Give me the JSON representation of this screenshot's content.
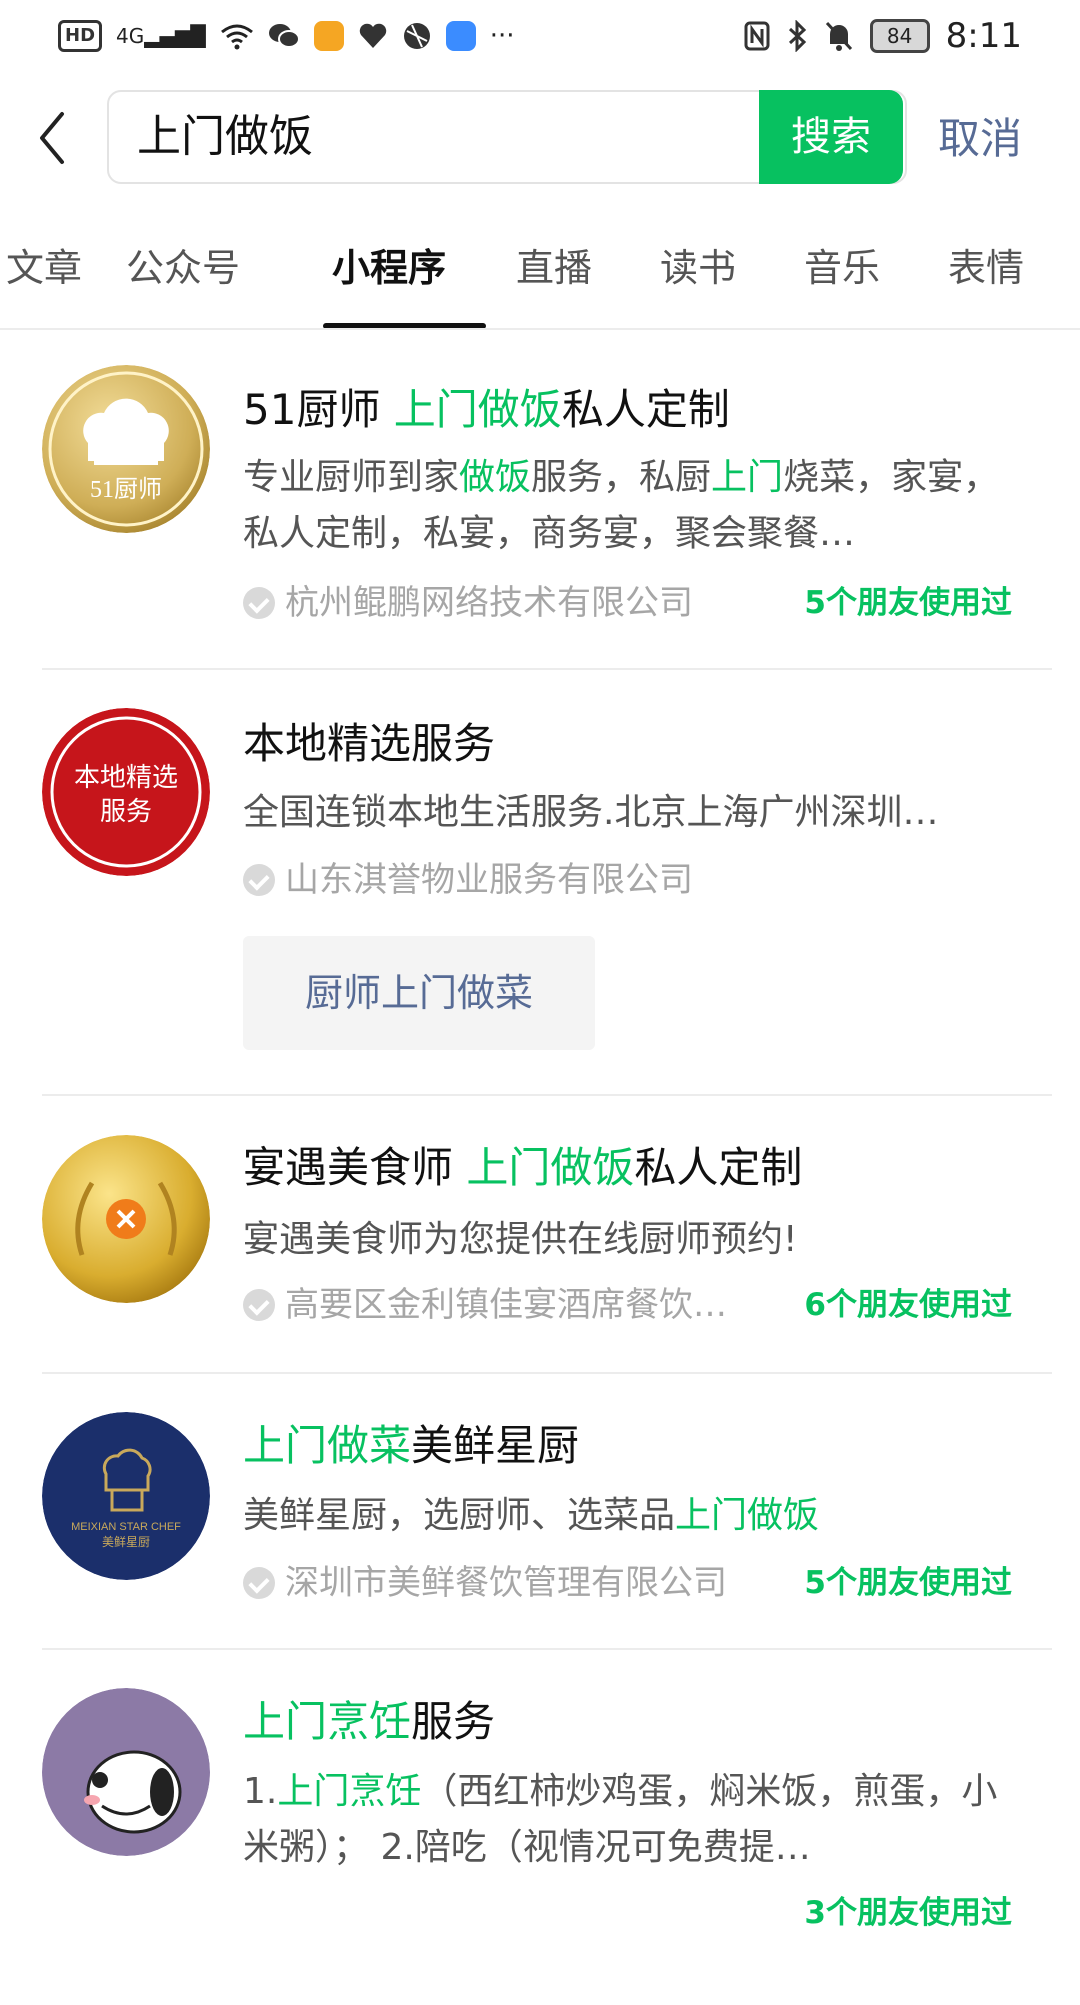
{
  "status_bar": {
    "hd": "HD",
    "network": "4G",
    "battery": "84",
    "time": "8:11",
    "overflow": "···"
  },
  "header": {
    "search_value": "上门做饭",
    "search_button": "搜索",
    "cancel": "取消"
  },
  "tabs": [
    {
      "label": "文章"
    },
    {
      "label": "公众号"
    },
    {
      "label": "小程序"
    },
    {
      "label": "直播"
    },
    {
      "label": "读书"
    },
    {
      "label": "音乐"
    },
    {
      "label": "表情"
    }
  ],
  "active_tab": "小程序",
  "results": [
    {
      "title_pre": "51厨师 ",
      "title_hl": "上门做饭",
      "title_post": "私人定制",
      "desc": [
        {
          "t": "专业厨师到家",
          "h": false
        },
        {
          "t": "做饭",
          "h": true
        },
        {
          "t": "服务，私厨",
          "h": false
        },
        {
          "t": "上门",
          "h": true
        },
        {
          "t": "烧菜，家宴，私人定制，私宴，商务宴，聚会聚餐…",
          "h": false
        }
      ],
      "source": "杭州鲲鹏网络技术有限公司",
      "friends": "5个朋友使用过",
      "avatar_text": "51厨师"
    },
    {
      "title_pre": "本地精选服务",
      "title_hl": "",
      "title_post": "",
      "desc": [
        {
          "t": "全国连锁本地生活服务.北京上海广州深圳…",
          "h": false
        }
      ],
      "source": "山东淇誉物业服务有限公司",
      "friends": "",
      "service": "厨师上门做菜",
      "avatar_text_line1": "本地精选",
      "avatar_text_line2": "服务"
    },
    {
      "title_pre": "宴遇美食师 ",
      "title_hl": "上门做饭",
      "title_post": "私人定制",
      "desc": [
        {
          "t": "宴遇美食师为您提供在线厨师预约!",
          "h": false
        }
      ],
      "source": "高要区金利镇佳宴酒席餐饮…",
      "friends": "6个朋友使用过"
    },
    {
      "title_pre": "",
      "title_hl": "上门做菜",
      "title_post": "美鲜星厨",
      "desc": [
        {
          "t": "美鲜星厨，选厨师、选菜品",
          "h": false
        },
        {
          "t": "上门做饭",
          "h": true
        }
      ],
      "source": "深圳市美鲜餐饮管理有限公司",
      "friends": "5个朋友使用过",
      "avatar_text_line1": "MEIXIAN STAR CHEF",
      "avatar_text_line2": "美鲜星厨"
    },
    {
      "title_pre": "",
      "title_hl": "上门烹饪",
      "title_post": "服务",
      "desc": [
        {
          "t": "1.",
          "h": false
        },
        {
          "t": "上门烹饪",
          "h": true
        },
        {
          "t": "（西红柿炒鸡蛋，焖米饭，煎蛋，小米粥）； 2.陪吃（视情况可免费提…",
          "h": false
        }
      ],
      "source": "",
      "friends": "3个朋友使用过"
    }
  ],
  "colors": {
    "accent": "#07c160",
    "link": "#576b95",
    "text_secondary": "#555555",
    "text_muted": "#a6a6a6"
  }
}
